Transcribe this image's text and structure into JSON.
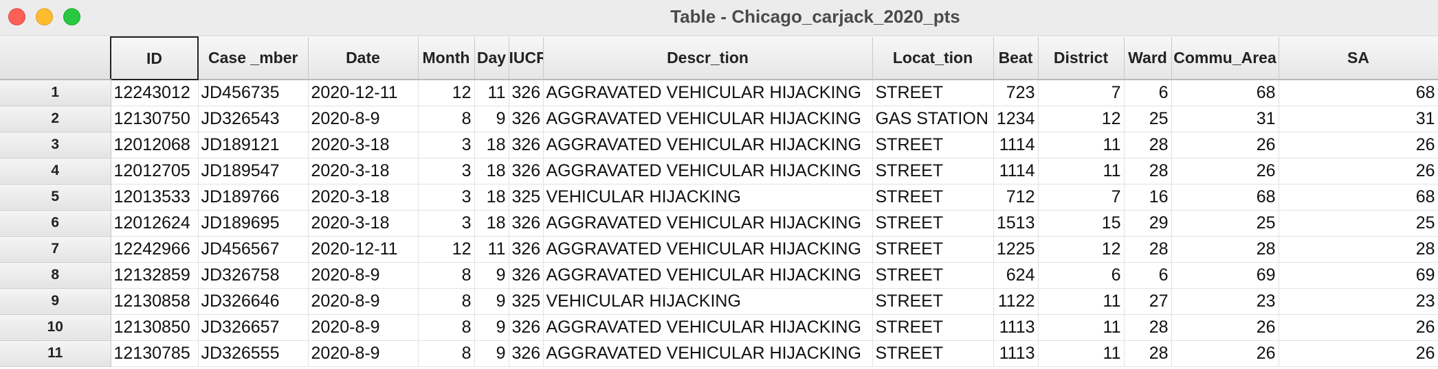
{
  "window": {
    "title": "Table - Chicago_carjack_2020_pts"
  },
  "table": {
    "columns": [
      "ID",
      "Case _mber",
      "Date",
      "Month",
      "Day",
      "IUCR",
      "Descr_tion",
      "Locat_tion",
      "Beat",
      "District",
      "Ward",
      "Commu_Area",
      "SA"
    ],
    "rows": [
      {
        "n": "1",
        "cells": [
          "12243012",
          "JD456735",
          "2020-12-11",
          "12",
          "11",
          "326",
          "AGGRAVATED VEHICULAR HIJACKING",
          "STREET",
          "723",
          "7",
          "6",
          "68",
          "68"
        ]
      },
      {
        "n": "2",
        "cells": [
          "12130750",
          "JD326543",
          "2020-8-9",
          "8",
          "9",
          "326",
          "AGGRAVATED VEHICULAR HIJACKING",
          "GAS STATION",
          "1234",
          "12",
          "25",
          "31",
          "31"
        ]
      },
      {
        "n": "3",
        "cells": [
          "12012068",
          "JD189121",
          "2020-3-18",
          "3",
          "18",
          "326",
          "AGGRAVATED VEHICULAR HIJACKING",
          "STREET",
          "1114",
          "11",
          "28",
          "26",
          "26"
        ]
      },
      {
        "n": "4",
        "cells": [
          "12012705",
          "JD189547",
          "2020-3-18",
          "3",
          "18",
          "326",
          "AGGRAVATED VEHICULAR HIJACKING",
          "STREET",
          "1114",
          "11",
          "28",
          "26",
          "26"
        ]
      },
      {
        "n": "5",
        "cells": [
          "12013533",
          "JD189766",
          "2020-3-18",
          "3",
          "18",
          "325",
          "VEHICULAR HIJACKING",
          "STREET",
          "712",
          "7",
          "16",
          "68",
          "68"
        ]
      },
      {
        "n": "6",
        "cells": [
          "12012624",
          "JD189695",
          "2020-3-18",
          "3",
          "18",
          "326",
          "AGGRAVATED VEHICULAR HIJACKING",
          "STREET",
          "1513",
          "15",
          "29",
          "25",
          "25"
        ]
      },
      {
        "n": "7",
        "cells": [
          "12242966",
          "JD456567",
          "2020-12-11",
          "12",
          "11",
          "326",
          "AGGRAVATED VEHICULAR HIJACKING",
          "STREET",
          "1225",
          "12",
          "28",
          "28",
          "28"
        ]
      },
      {
        "n": "8",
        "cells": [
          "12132859",
          "JD326758",
          "2020-8-9",
          "8",
          "9",
          "326",
          "AGGRAVATED VEHICULAR HIJACKING",
          "STREET",
          "624",
          "6",
          "6",
          "69",
          "69"
        ]
      },
      {
        "n": "9",
        "cells": [
          "12130858",
          "JD326646",
          "2020-8-9",
          "8",
          "9",
          "325",
          "VEHICULAR HIJACKING",
          "STREET",
          "1122",
          "11",
          "27",
          "23",
          "23"
        ]
      },
      {
        "n": "10",
        "cells": [
          "12130850",
          "JD326657",
          "2020-8-9",
          "8",
          "9",
          "326",
          "AGGRAVATED VEHICULAR HIJACKING",
          "STREET",
          "1113",
          "11",
          "28",
          "26",
          "26"
        ]
      },
      {
        "n": "11",
        "cells": [
          "12130785",
          "JD326555",
          "2020-8-9",
          "8",
          "9",
          "326",
          "AGGRAVATED VEHICULAR HIJACKING",
          "STREET",
          "1113",
          "11",
          "28",
          "26",
          "26"
        ]
      }
    ]
  },
  "colors": {
    "close": "#fe5f57",
    "minimize": "#febc2e",
    "maximize": "#28c840"
  }
}
